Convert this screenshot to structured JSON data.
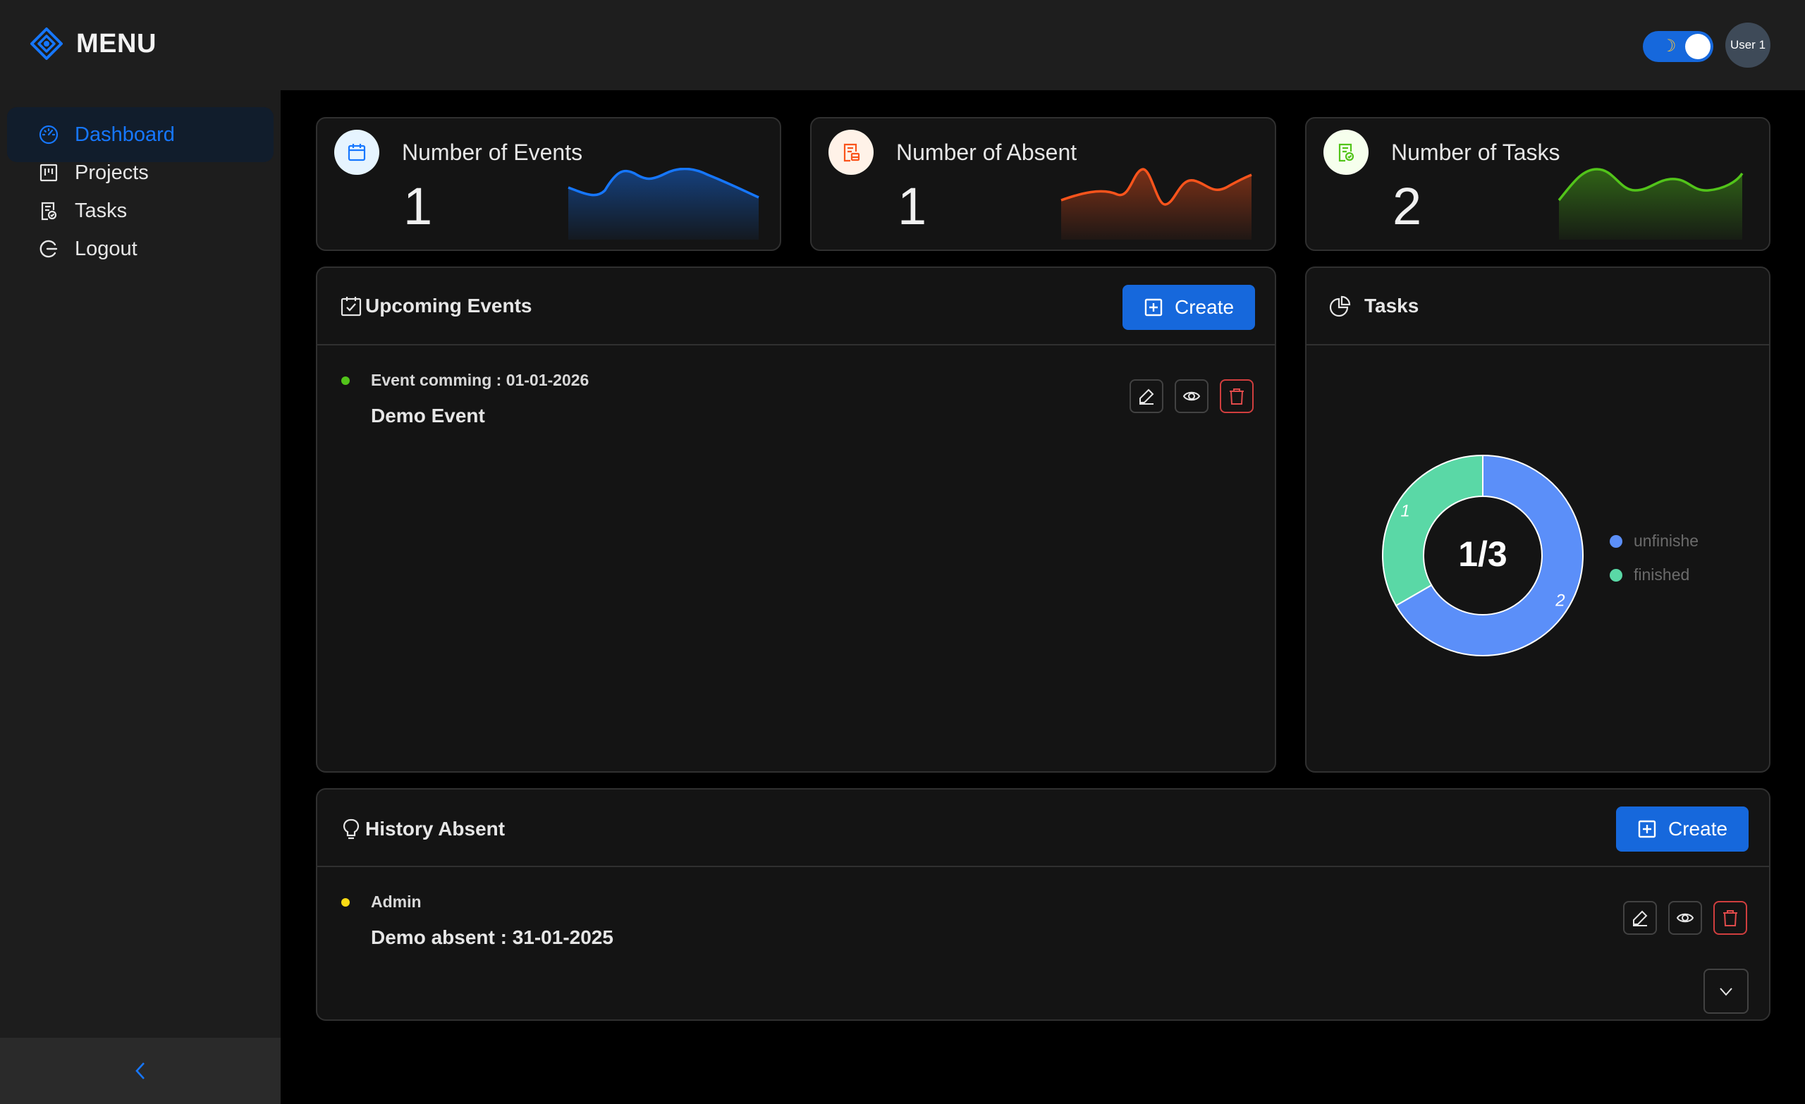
{
  "app": {
    "title": "MENU"
  },
  "header": {
    "user_label": "User 1",
    "theme_icon": "moon-icon"
  },
  "sidebar": {
    "items": [
      {
        "label": "Dashboard",
        "icon": "dashboard-icon",
        "active": true
      },
      {
        "label": "Projects",
        "icon": "projects-icon"
      },
      {
        "label": "Tasks",
        "icon": "tasks-icon"
      },
      {
        "label": "Logout",
        "icon": "logout-icon"
      }
    ],
    "collapse_label": "<"
  },
  "stats": [
    {
      "label": "Number of Events",
      "value": "1",
      "color": "#1677ff",
      "icon_bg": "#e6f4ff",
      "icon": "calendar-icon"
    },
    {
      "label": "Number of Absent",
      "value": "1",
      "color": "#fa541c",
      "icon_bg": "#fff2e8",
      "icon": "absent-doc-icon"
    },
    {
      "label": "Number of Tasks",
      "value": "2",
      "color": "#52c41a",
      "icon_bg": "#f6ffed",
      "icon": "task-doc-icon"
    }
  ],
  "upcoming_events": {
    "title": "Upcoming Events",
    "create_label": "Create",
    "items": [
      {
        "subtitle": "Event comming : 01-01-2026",
        "title": "Demo Event",
        "dot_color": "#52c41a"
      }
    ]
  },
  "tasks_panel": {
    "title": "Tasks",
    "center_label": "1/3",
    "chart_data": {
      "type": "pie",
      "slices": [
        {
          "name": "unfinished",
          "value": 2,
          "color": "#5b8ff9"
        },
        {
          "name": "finished",
          "value": 1,
          "color": "#5ad8a6"
        }
      ],
      "legend": [
        "unfinishe",
        "finished"
      ],
      "legend_position": "right"
    }
  },
  "history_absent": {
    "title": "History Absent",
    "create_label": "Create",
    "items": [
      {
        "subtitle": "Admin",
        "title": "Demo absent : 31-01-2025",
        "dot_color": "#fadb14"
      }
    ]
  }
}
